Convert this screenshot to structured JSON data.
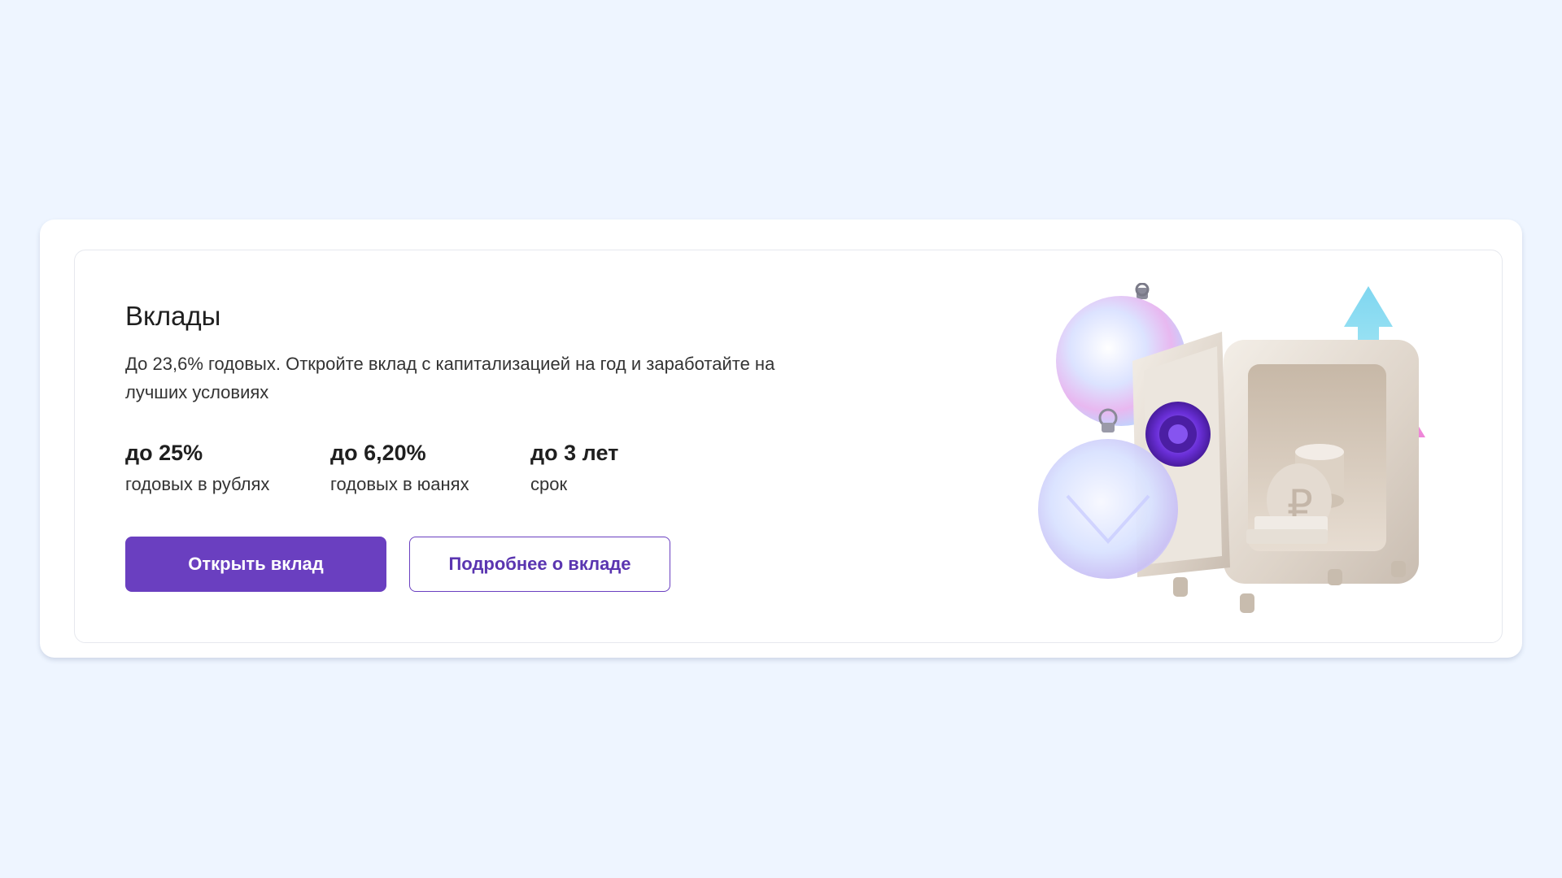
{
  "card": {
    "title": "Вклады",
    "description": "До 23,6% годовых. Откройте вклад с капитализацией на год и заработайте на лучших условиях",
    "stats": [
      {
        "value": "до 25%",
        "label": "годовых в рублях"
      },
      {
        "value": "до 6,20%",
        "label": "годовых в юанях"
      },
      {
        "value": "до 3 лет",
        "label": "срок"
      }
    ],
    "buttons": {
      "primary_label": "Открыть вклад",
      "secondary_label": "Подробнее о вкладе"
    },
    "illustration": {
      "icon": "safe-with-ornaments-and-arrows-icon"
    }
  },
  "colors": {
    "page_background": "#eef5ff",
    "accent": "#6a3fc0",
    "text": "#1f1f1f"
  }
}
